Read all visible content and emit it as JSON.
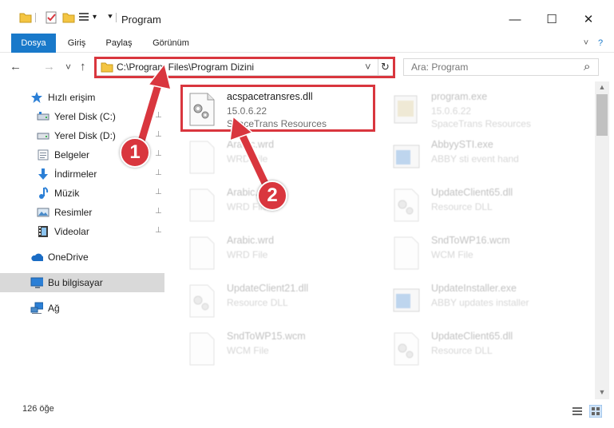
{
  "window": {
    "title": "Program",
    "minimize_glyph": "—",
    "maximize_glyph": "☐",
    "close_glyph": "✕"
  },
  "ribbon": {
    "tabs": [
      {
        "label": "Dosya",
        "active": true
      },
      {
        "label": "Giriş",
        "active": false
      },
      {
        "label": "Paylaş",
        "active": false
      },
      {
        "label": "Görünüm",
        "active": false
      }
    ],
    "help_glyph": "?"
  },
  "nav_buttons": {
    "back": "←",
    "forward": "→",
    "recent": "˅",
    "up": "↑"
  },
  "address_bar": {
    "path": "C:\\Program Files\\Program Dizini",
    "dropdown_glyph": "˅",
    "refresh_glyph": "↻"
  },
  "search": {
    "placeholder": "Ara: Program",
    "icon_glyph": "⌕"
  },
  "navigation_pane": {
    "items": [
      {
        "label": "Hızlı erişim",
        "icon": "star-icon"
      },
      {
        "label": "Yerel Disk (C:)",
        "icon": "drive-icon",
        "pinned": true
      },
      {
        "label": "Yerel Disk (D:)",
        "icon": "drive-icon",
        "pinned": true
      },
      {
        "label": "Belgeler",
        "icon": "documents-icon",
        "pinned": true
      },
      {
        "label": "İndirmeler",
        "icon": "download-icon",
        "pinned": true
      },
      {
        "label": "Müzik",
        "icon": "music-icon",
        "pinned": true
      },
      {
        "label": "Resimler",
        "icon": "pictures-icon",
        "pinned": true
      },
      {
        "label": "Videolar",
        "icon": "videos-icon",
        "pinned": true
      },
      {
        "label": "OneDrive",
        "icon": "cloud-icon"
      },
      {
        "label": "Bu bilgisayar",
        "icon": "computer-icon",
        "selected": true
      },
      {
        "label": "Ağ",
        "icon": "network-icon"
      }
    ],
    "pin_glyph": "📌"
  },
  "files": [
    {
      "name": "acspacetransres.dll",
      "version": "15.0.6.22",
      "description": "SpaceTrans Resources",
      "icon": "dll-gear-icon",
      "highlighted": true
    },
    {
      "name": "program.exe",
      "version": "15.0.6.22",
      "description": "SpaceTrans Resources",
      "icon": "exe-icon"
    },
    {
      "name": "Arabic.wrd",
      "version": "WRD File",
      "description": "",
      "icon": "blank-file-icon"
    },
    {
      "name": "AbbyySTI.exe",
      "version": "ABBY sti event hand",
      "description": "",
      "icon": "exe-window-icon"
    },
    {
      "name": "Arabic.wrd",
      "version": "WRD File",
      "description": "",
      "icon": "blank-file-icon"
    },
    {
      "name": "UpdateClient65.dll",
      "version": "Resource DLL",
      "description": "",
      "icon": "dll-gear-icon"
    },
    {
      "name": "Arabic.wrd",
      "version": "WRD File",
      "description": "",
      "icon": "blank-file-icon"
    },
    {
      "name": "SndToWP16.wcm",
      "version": "WCM File",
      "description": "",
      "icon": "blank-file-icon"
    },
    {
      "name": "UpdateClient21.dll",
      "version": "Resource DLL",
      "description": "",
      "icon": "dll-gear-icon"
    },
    {
      "name": "UpdateInstaller.exe",
      "version": "ABBY updates installer",
      "description": "",
      "icon": "exe-window-icon"
    },
    {
      "name": "SndToWP15.wcm",
      "version": "WCM File",
      "description": "",
      "icon": "blank-file-icon"
    },
    {
      "name": "UpdateClient65.dll",
      "version": "Resource DLL",
      "description": "",
      "icon": "dll-gear-icon"
    }
  ],
  "status_bar": {
    "item_count": "126 öğe"
  },
  "annotations": {
    "badge_1": "1",
    "badge_2": "2"
  },
  "colors": {
    "accent": "#1979ca",
    "highlight": "#d9363e",
    "selected_nav": "#d9d9d9"
  }
}
